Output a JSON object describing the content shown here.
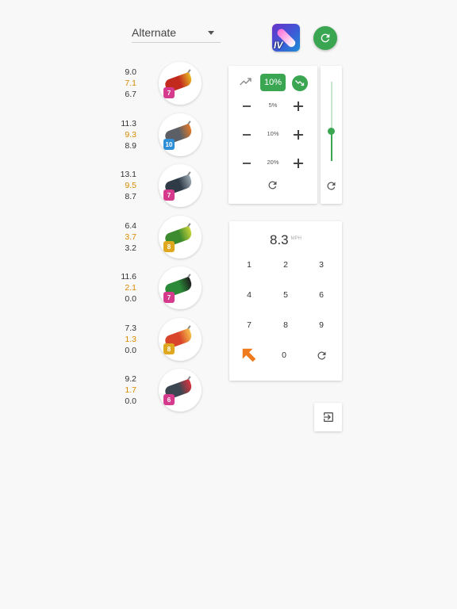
{
  "dropdown": {
    "selected": "Alternate"
  },
  "app_icon": {
    "label": "IV"
  },
  "clubs": [
    {
      "v1": "9.0",
      "v2": "7.1",
      "v3": "6.7",
      "badge": "7",
      "badge_color": "#d63a8c",
      "head_color": "#c22a1e",
      "accent": "#e6b422"
    },
    {
      "v1": "11.3",
      "v2": "9.3",
      "v3": "8.9",
      "badge": "10",
      "badge_color": "#2f8fd6",
      "head_color": "#5c6066",
      "accent": "#e07a2a"
    },
    {
      "v1": "13.1",
      "v2": "9.5",
      "v3": "8.7",
      "badge": "7",
      "badge_color": "#d63a8c",
      "head_color": "#2f3b46",
      "accent": "#9aa7b1"
    },
    {
      "v1": "6.4",
      "v2": "3.7",
      "v3": "3.2",
      "badge": "8",
      "badge_color": "#e0a81e",
      "head_color": "#3c8b2e",
      "accent": "#c7d43a"
    },
    {
      "v1": "11.6",
      "v2": "2.1",
      "v3": "0.0",
      "badge": "7",
      "badge_color": "#d63a8c",
      "head_color": "#2a8a38",
      "accent": "#1d1d1d"
    },
    {
      "v1": "7.3",
      "v2": "1.3",
      "v3": "0.0",
      "badge": "8",
      "badge_color": "#e0a81e",
      "head_color": "#d9452a",
      "accent": "#f6c04a"
    },
    {
      "v1": "9.2",
      "v2": "1.7",
      "v3": "0.0",
      "badge": "6",
      "badge_color": "#d63a8c",
      "head_color": "#3b4650",
      "accent": "#d9343f"
    }
  ],
  "percent": {
    "current": "10%",
    "steps": [
      "5%",
      "10%",
      "20%"
    ]
  },
  "slider": {
    "level": 0.38
  },
  "keypad": {
    "speed": "8.3",
    "unit": "MPH",
    "keys": [
      "1",
      "2",
      "3",
      "4",
      "5",
      "6",
      "7",
      "8",
      "9",
      "0"
    ]
  },
  "colors": {
    "accent_green": "#3aa652",
    "value_orange": "#d98a00",
    "arrow_orange": "#f07b1c"
  },
  "icons": {
    "refresh": "refresh-icon",
    "trend_up": "trending-up-icon",
    "trend_down": "trending-down-icon",
    "exit": "exit-to-app-icon",
    "arrow": "arrow-up-left-icon"
  }
}
